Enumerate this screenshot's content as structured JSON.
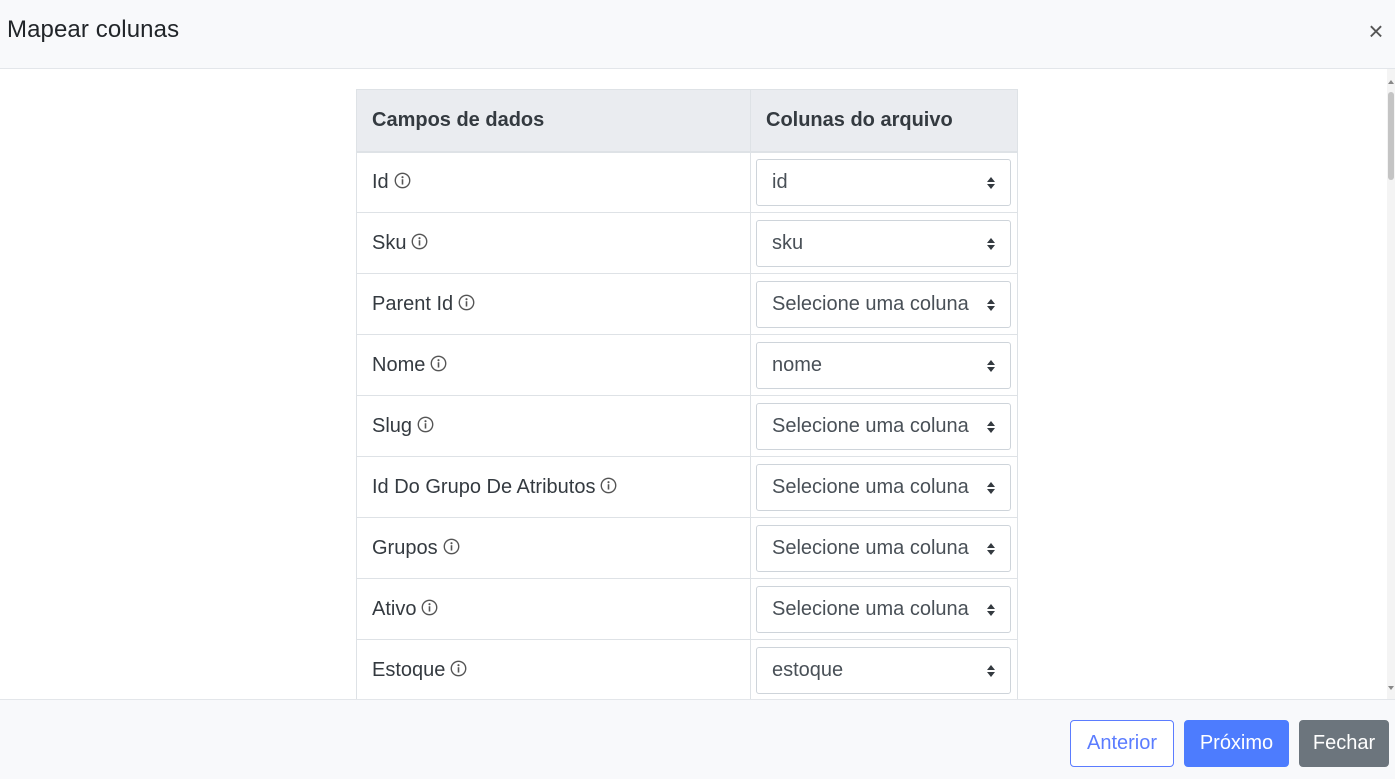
{
  "modal": {
    "title": "Mapear colunas",
    "close_icon": "×"
  },
  "table": {
    "headers": {
      "fields": "Campos de dados",
      "file_columns": "Colunas do arquivo"
    },
    "rows": [
      {
        "field": "Id",
        "selected": "id"
      },
      {
        "field": "Sku",
        "selected": "sku"
      },
      {
        "field": "Parent Id",
        "selected": "Selecione uma coluna"
      },
      {
        "field": "Nome",
        "selected": "nome"
      },
      {
        "field": "Slug",
        "selected": "Selecione uma coluna"
      },
      {
        "field": "Id Do Grupo De Atributos",
        "selected": "Selecione uma coluna"
      },
      {
        "field": "Grupos",
        "selected": "Selecione uma coluna"
      },
      {
        "field": "Ativo",
        "selected": "Selecione uma coluna"
      },
      {
        "field": "Estoque",
        "selected": "estoque"
      }
    ]
  },
  "footer": {
    "prev_label": "Anterior",
    "next_label": "Próximo",
    "close_label": "Fechar"
  },
  "colors": {
    "primary": "#4d7cfe",
    "secondary": "#6c757d",
    "header_bg": "#eaecf0"
  }
}
